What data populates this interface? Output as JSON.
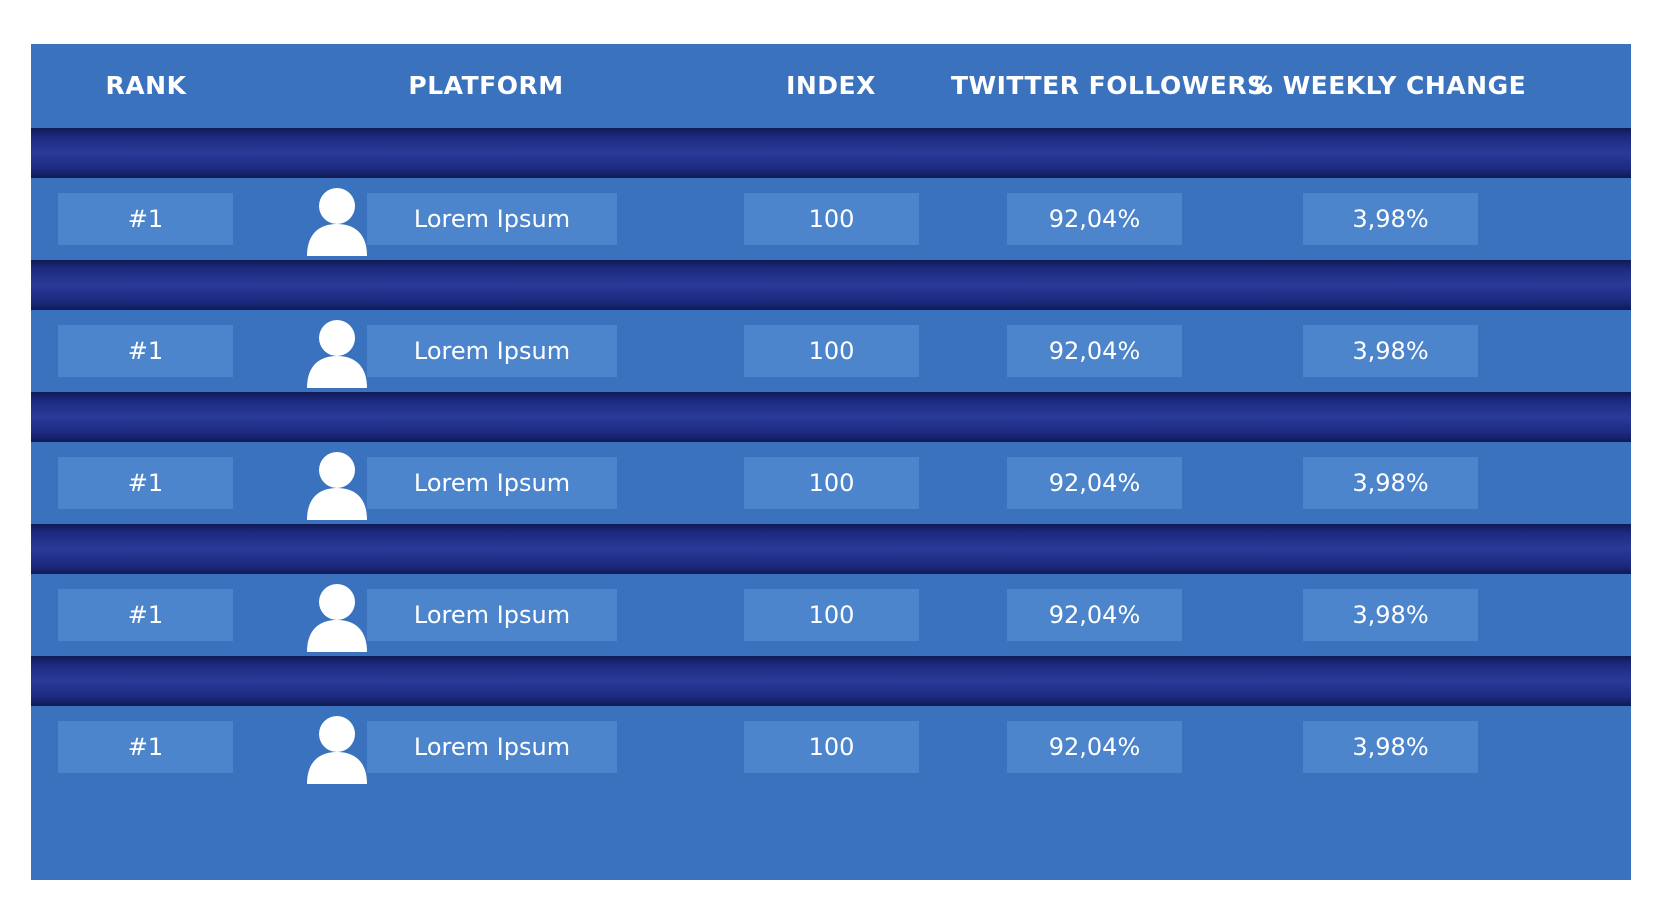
{
  "table": {
    "headers": {
      "rank": "RANK",
      "platform": "PLATFORM",
      "index": "INDEX",
      "followers": "TWITTER FOLLOWERS",
      "weekly_change": "% WEEKLY CHANGE"
    },
    "rows": [
      {
        "rank": "#1",
        "avatar_icon": "user-icon",
        "platform": "Lorem Ipsum",
        "index": "100",
        "followers": "92,04%",
        "weekly_change": "3,98%"
      },
      {
        "rank": "#1",
        "avatar_icon": "user-icon",
        "platform": "Lorem Ipsum",
        "index": "100",
        "followers": "92,04%",
        "weekly_change": "3,98%"
      },
      {
        "rank": "#1",
        "avatar_icon": "user-icon",
        "platform": "Lorem Ipsum",
        "index": "100",
        "followers": "92,04%",
        "weekly_change": "3,98%"
      },
      {
        "rank": "#1",
        "avatar_icon": "user-icon",
        "platform": "Lorem Ipsum",
        "index": "100",
        "followers": "92,04%",
        "weekly_change": "3,98%"
      },
      {
        "rank": "#1",
        "avatar_icon": "user-icon",
        "platform": "Lorem Ipsum",
        "index": "100",
        "followers": "92,04%",
        "weekly_change": "3,98%"
      }
    ]
  },
  "colors": {
    "row_background": "#3a72bd",
    "cell_background": "#4d85cc",
    "separator_dark": "#1c2a80",
    "text": "#ffffff"
  }
}
